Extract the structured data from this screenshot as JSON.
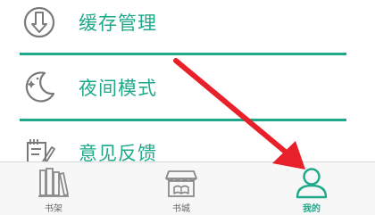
{
  "menu": {
    "items": [
      {
        "label": "缓存管理",
        "icon": "download-circle-icon"
      },
      {
        "label": "夜间模式",
        "icon": "moon-icon"
      },
      {
        "label": "意见反馈",
        "icon": "feedback-edit-icon"
      }
    ]
  },
  "tabbar": {
    "tabs": [
      {
        "label": "书架",
        "icon": "bookshelf-icon",
        "active": false
      },
      {
        "label": "书城",
        "icon": "bookstore-icon",
        "active": false
      },
      {
        "label": "我的",
        "icon": "user-profile-icon",
        "active": true
      }
    ]
  },
  "colors": {
    "accent": "#1ea98a",
    "divider": "#1ea98a",
    "inactive_icon": "#8a8a8a",
    "annotation_arrow": "#e8202a",
    "tabbar_background": "#f7f7f7"
  },
  "annotation": {
    "type": "red-arrow",
    "points_to": "tab-mine"
  }
}
